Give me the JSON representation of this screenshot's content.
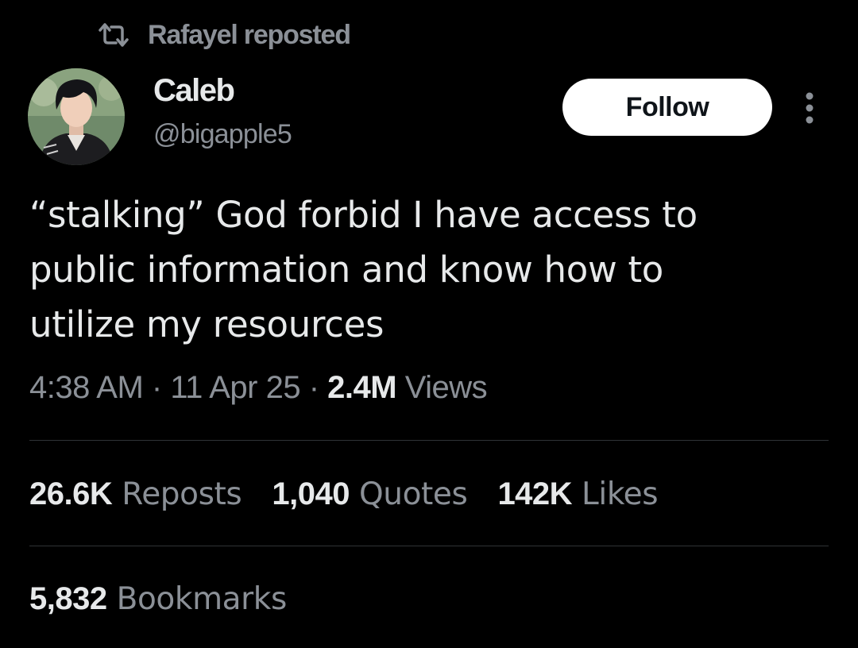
{
  "repost": {
    "icon": "repost-icon",
    "text": "Rafayel reposted"
  },
  "author": {
    "avatar": "avatar-photo",
    "name": "Caleb",
    "handle": "@bigapple5"
  },
  "follow_button": {
    "label": "Follow"
  },
  "more_button": {
    "icon": "more-vertical-icon"
  },
  "tweet": {
    "lines": [
      "“stalking” God forbid I have access to",
      "public information and know how to",
      "utilize my resources"
    ]
  },
  "meta": {
    "time": "4:38 AM",
    "separator1": " · ",
    "date": "11 Apr 25",
    "separator2": " · ",
    "views_count": "2.4M",
    "views_label": " Views"
  },
  "stats": {
    "reposts": {
      "count": "26.6K",
      "label": " Reposts"
    },
    "quotes": {
      "count": "1,040",
      "label": " Quotes"
    },
    "likes": {
      "count": "142K",
      "label": " Likes"
    },
    "bookmarks": {
      "count": "5,832",
      "label": " Bookmarks"
    }
  },
  "colors": {
    "background": "#000000",
    "text_primary": "#e7e9ea",
    "text_secondary": "#8b9097",
    "divider": "#2f3336",
    "button_bg": "#ffffff",
    "button_text": "#0f1419"
  }
}
